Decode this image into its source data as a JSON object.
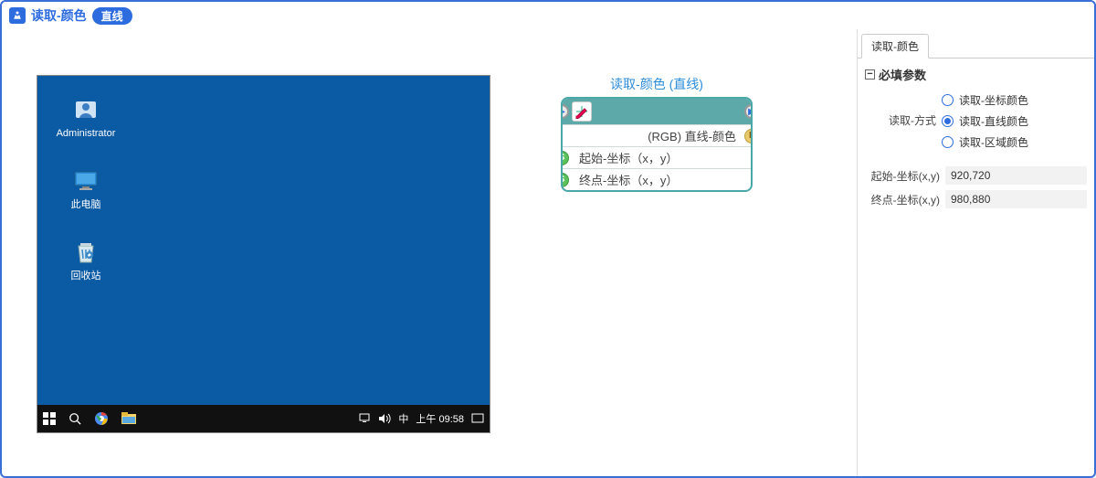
{
  "titleBar": {
    "title": "读取-颜色",
    "badge": "直线"
  },
  "desktop": {
    "icons": [
      {
        "name": "administrator",
        "label": "Administrator"
      },
      {
        "name": "this-pc",
        "label": "此电脑"
      },
      {
        "name": "recycle-bin",
        "label": "回收站"
      }
    ],
    "taskbar": {
      "ime": "中",
      "time": "上午 09:58"
    }
  },
  "node": {
    "title": "读取-颜色 (直线)",
    "output": "(RGB) 直线-颜色",
    "inputs": [
      "起始-坐标（x，y）",
      "终点-坐标（x，y）"
    ]
  },
  "panel": {
    "tab": "读取-颜色",
    "sectionTitle": "必填参数",
    "methodLabel": "读取-方式",
    "options": [
      {
        "label": "读取-坐标颜色",
        "checked": false
      },
      {
        "label": "读取-直线颜色",
        "checked": true
      },
      {
        "label": "读取-区域颜色",
        "checked": false
      }
    ],
    "fields": [
      {
        "label": "起始-坐标(x,y)",
        "value": "920,720"
      },
      {
        "label": "终点-坐标(x,y)",
        "value": "980,880"
      }
    ]
  }
}
